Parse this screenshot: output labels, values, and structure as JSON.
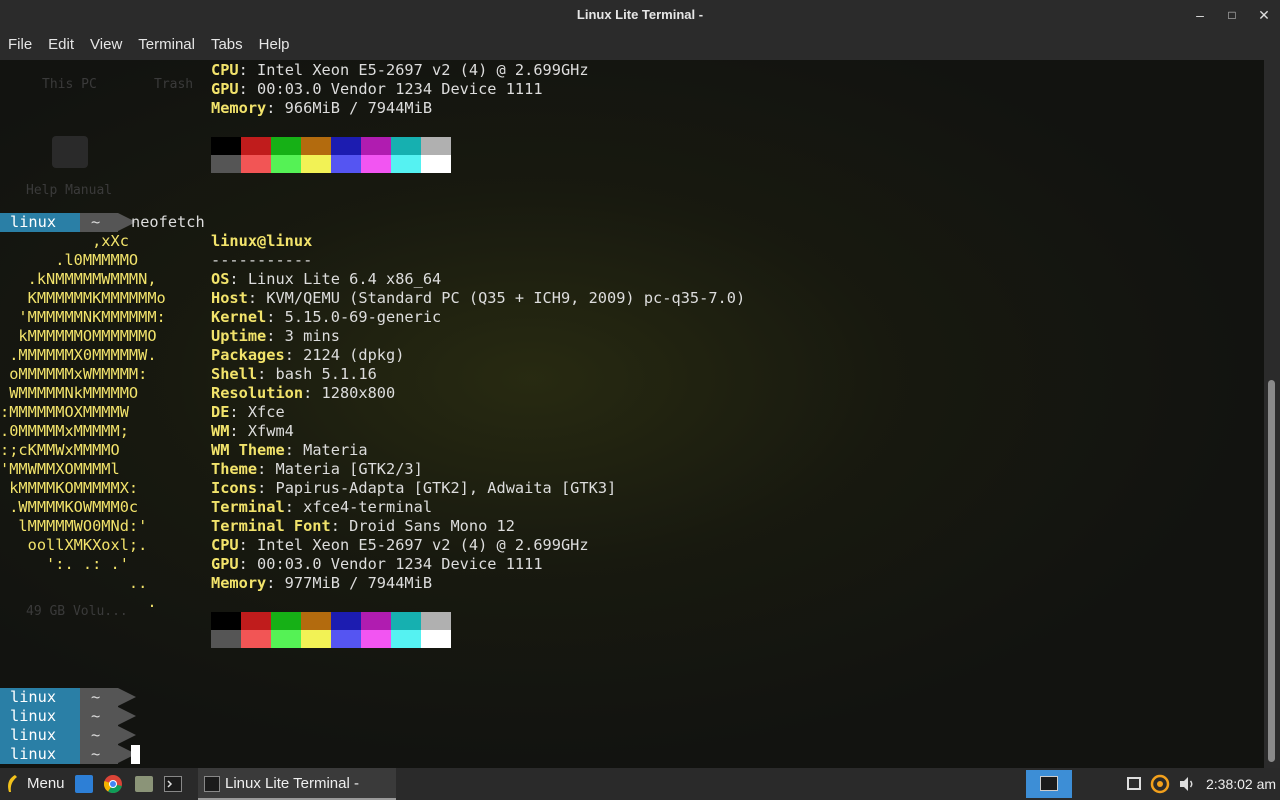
{
  "window": {
    "title": "Linux Lite Terminal -"
  },
  "controls": {
    "minimize": "–",
    "maximize": "□",
    "close": "✕"
  },
  "menu": [
    "File",
    "Edit",
    "View",
    "Terminal",
    "Tabs",
    "Help"
  ],
  "desktop_icons": [
    "This PC",
    "Trash",
    "Help Manual",
    "49 GB Volu..."
  ],
  "prev_output": [
    {
      "label": "CPU",
      "value": ": Intel Xeon E5-2697 v2 (4) @ 2.699GHz"
    },
    {
      "label": "GPU",
      "value": ": 00:03.0 Vendor 1234 Device 1111"
    },
    {
      "label": "Memory",
      "value": ": 966MiB / 7944MiB"
    }
  ],
  "prompt": {
    "user": "linux",
    "dir": "~",
    "command": "neofetch"
  },
  "neofetch": {
    "userhost": "linux@linux",
    "separator": "-----------",
    "info": [
      {
        "label": "OS",
        "value": ": Linux Lite 6.4 x86_64"
      },
      {
        "label": "Host",
        "value": ": KVM/QEMU (Standard PC (Q35 + ICH9, 2009) pc-q35-7.0)"
      },
      {
        "label": "Kernel",
        "value": ": 5.15.0-69-generic"
      },
      {
        "label": "Uptime",
        "value": ": 3 mins"
      },
      {
        "label": "Packages",
        "value": ": 2124 (dpkg)"
      },
      {
        "label": "Shell",
        "value": ": bash 5.1.16"
      },
      {
        "label": "Resolution",
        "value": ": 1280x800"
      },
      {
        "label": "DE",
        "value": ": Xfce"
      },
      {
        "label": "WM",
        "value": ": Xfwm4"
      },
      {
        "label": "WM Theme",
        "value": ": Materia"
      },
      {
        "label": "Theme",
        "value": ": Materia [GTK2/3]"
      },
      {
        "label": "Icons",
        "value": ": Papirus-Adapta [GTK2], Adwaita [GTK3]"
      },
      {
        "label": "Terminal",
        "value": ": xfce4-terminal"
      },
      {
        "label": "Terminal Font",
        "value": ": Droid Sans Mono 12"
      },
      {
        "label": "CPU",
        "value": ": Intel Xeon E5-2697 v2 (4) @ 2.699GHz"
      },
      {
        "label": "GPU",
        "value": ": 00:03.0 Vendor 1234 Device 1111"
      },
      {
        "label": "Memory",
        "value": ": 977MiB / 7944MiB"
      }
    ],
    "logo": [
      "          ,xXc",
      "      .l0MMMMMO",
      "   .kNMMMMMWMMMN,",
      "   KMMMMMMKMMMMMMo",
      "  'MMMMMMNKMMMMMM:",
      "  kMMMMMMOMMMMMMO",
      " .MMMMMMX0MMMMMW.",
      " oMMMMMMxWMMMMM:",
      " WMMMMMNkMMMMMO",
      ":MMMMMMOXMMMMW",
      ".0MMMMMxMMMMM;",
      ":;cKMMWxMMMMO",
      "'MMWMMXOMMMMl",
      " kMMMMKOMMMMMX:",
      " .WMMMMKOWMMM0c",
      "  lMMMMMWO0MNd:'",
      "   oollXMKXoxl;.",
      "     ':. .: .'",
      "              ..",
      "                ."
    ]
  },
  "colors": {
    "row1": [
      "#000000",
      "#c01c1c",
      "#16b016",
      "#b36b0e",
      "#1c1cb0",
      "#b01cb0",
      "#16b0b0",
      "#b0b0b0"
    ],
    "row2": [
      "#555555",
      "#f25555",
      "#55f255",
      "#f2f255",
      "#5555f2",
      "#f255f2",
      "#55f2f2",
      "#ffffff"
    ]
  },
  "taskbar": {
    "menu_label": "Menu",
    "task_label": "Linux Lite Terminal -",
    "clock": "2:38:02 am"
  }
}
